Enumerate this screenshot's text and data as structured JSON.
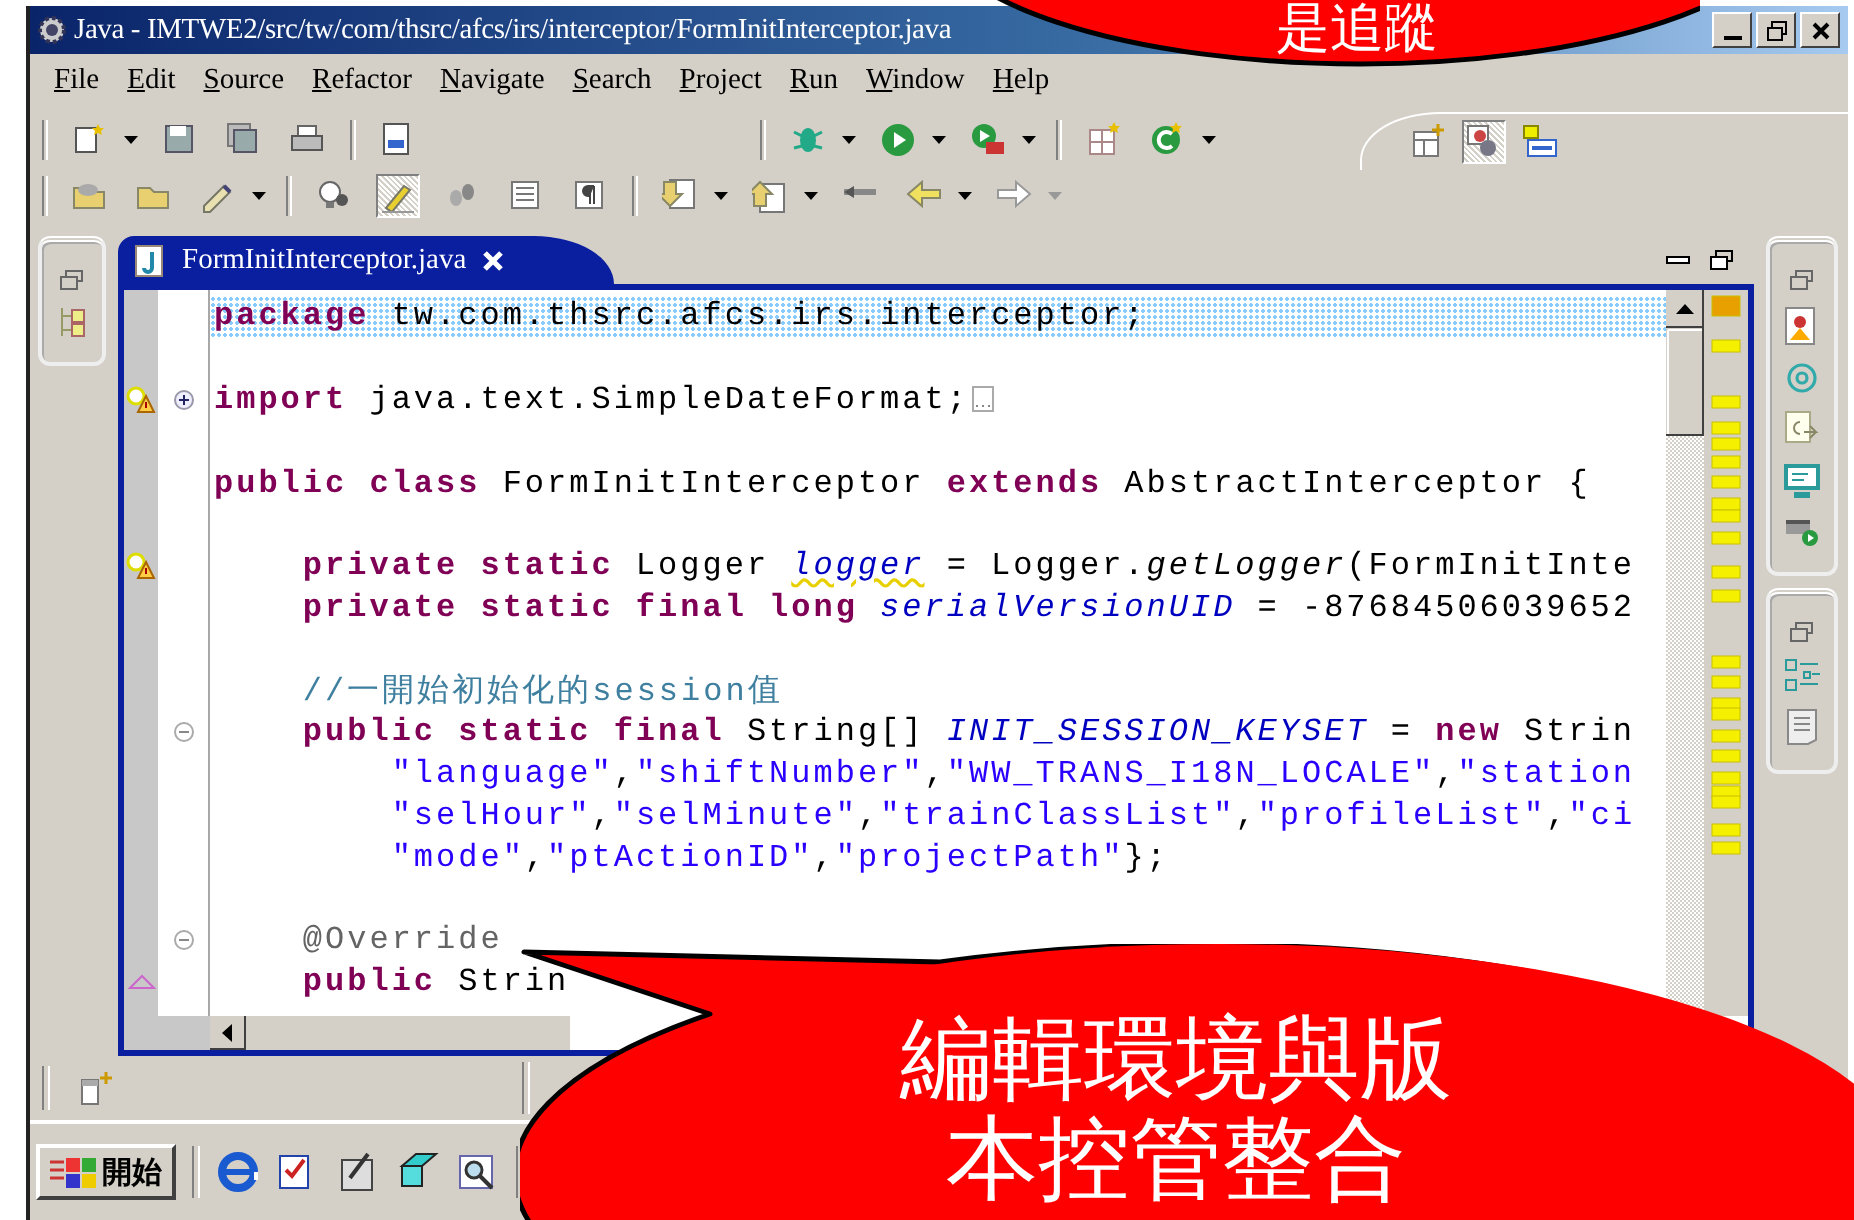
{
  "window": {
    "title": "Java - IMTWE2/src/tw/com/thsrc/afcs/irs/interceptor/FormInitInterceptor.java"
  },
  "menu": [
    "File",
    "Edit",
    "Source",
    "Refactor",
    "Navigate",
    "Search",
    "Project",
    "Run",
    "Window",
    "Help"
  ],
  "toolbar": {
    "highlight_toggle": {
      "on": true
    },
    "perspectives": [
      {
        "selected": false
      },
      {
        "selected": true
      },
      {
        "selected": false
      }
    ]
  },
  "editor": {
    "tab": {
      "label": "FormInitInterceptor.java",
      "selected": true
    },
    "lines": [
      {
        "kind": "code",
        "highlighted": true,
        "tokens": [
          {
            "kind": "keyword",
            "text": "package"
          },
          {
            "kind": "plain",
            "text": " tw.com.thsrc.afcs.irs.interceptor;"
          }
        ]
      },
      {
        "kind": "blank"
      },
      {
        "kind": "code",
        "warning": true,
        "fold_expanded": false,
        "tokens": [
          {
            "kind": "keyword",
            "text": "import"
          },
          {
            "kind": "plain",
            "text": " java.text.SimpleDateFormat;"
          }
        ]
      },
      {
        "kind": "blank"
      },
      {
        "kind": "code",
        "tokens": [
          {
            "kind": "keyword",
            "text": "public class"
          },
          {
            "kind": "plain",
            "text": " FormInitInterceptor "
          },
          {
            "kind": "keyword",
            "text": "extends"
          },
          {
            "kind": "plain",
            "text": " AbstractInterceptor {"
          }
        ]
      },
      {
        "kind": "blank"
      },
      {
        "kind": "code",
        "warning": true,
        "tokens": [
          {
            "kind": "keyword",
            "text": "    private static"
          },
          {
            "kind": "plain",
            "text": " Logger "
          },
          {
            "kind": "field_warning",
            "text": "logger"
          },
          {
            "kind": "plain",
            "text": " = Logger."
          },
          {
            "kind": "static_method",
            "text": "getLogger"
          },
          {
            "kind": "plain",
            "text": "(FormInitInte"
          }
        ]
      },
      {
        "kind": "code",
        "tokens": [
          {
            "kind": "keyword",
            "text": "    private static final long "
          },
          {
            "kind": "field",
            "text": "serialVersionUID"
          },
          {
            "kind": "plain",
            "text": " = -87684506039652"
          }
        ]
      },
      {
        "kind": "blank"
      },
      {
        "kind": "code",
        "tokens": [
          {
            "kind": "comment",
            "text": "    //一開始初始化的session值"
          }
        ]
      },
      {
        "kind": "code",
        "fold_expanded": true,
        "tokens": [
          {
            "kind": "keyword",
            "text": "    public static final"
          },
          {
            "kind": "plain",
            "text": " String[] "
          },
          {
            "kind": "field",
            "text": "INIT_SESSION_KEYSET"
          },
          {
            "kind": "plain",
            "text": " = "
          },
          {
            "kind": "keyword",
            "text": "new"
          },
          {
            "kind": "plain",
            "text": " Strin"
          }
        ]
      },
      {
        "kind": "code",
        "tokens": [
          {
            "kind": "string",
            "text": "        \"language\""
          },
          {
            "kind": "plain",
            "text": ","
          },
          {
            "kind": "string",
            "text": "\"shiftNumber\""
          },
          {
            "kind": "plain",
            "text": ","
          },
          {
            "kind": "string",
            "text": "\"WW_TRANS_I18N_LOCALE\""
          },
          {
            "kind": "plain",
            "text": ","
          },
          {
            "kind": "string",
            "text": "\"station"
          }
        ]
      },
      {
        "kind": "code",
        "tokens": [
          {
            "kind": "string",
            "text": "        \"selHour\""
          },
          {
            "kind": "plain",
            "text": ","
          },
          {
            "kind": "string",
            "text": "\"selMinute\""
          },
          {
            "kind": "plain",
            "text": ","
          },
          {
            "kind": "string",
            "text": "\"trainClassList\""
          },
          {
            "kind": "plain",
            "text": ","
          },
          {
            "kind": "string",
            "text": "\"profileList\""
          },
          {
            "kind": "plain",
            "text": ","
          },
          {
            "kind": "string",
            "text": "\"ci"
          }
        ]
      },
      {
        "kind": "code",
        "tokens": [
          {
            "kind": "string",
            "text": "        \"mode\""
          },
          {
            "kind": "plain",
            "text": ","
          },
          {
            "kind": "string",
            "text": "\"ptActionID\""
          },
          {
            "kind": "plain",
            "text": ","
          },
          {
            "kind": "string",
            "text": "\"projectPath\""
          },
          {
            "kind": "plain",
            "text": "};"
          }
        ]
      },
      {
        "kind": "blank"
      },
      {
        "kind": "code",
        "fold_expanded": true,
        "tokens": [
          {
            "kind": "annotation",
            "text": "    @Override"
          }
        ]
      },
      {
        "kind": "code",
        "change_marker": true,
        "tokens": [
          {
            "kind": "keyword",
            "text": "    public"
          },
          {
            "kind": "plain",
            "text": " Strin"
          }
        ]
      }
    ]
  },
  "taskbar": {
    "start_label": "開始"
  },
  "callouts": [
    {
      "lines": [
        "是追蹤"
      ]
    },
    {
      "lines": [
        "編輯環境與版",
        "本控管整合"
      ]
    }
  ]
}
